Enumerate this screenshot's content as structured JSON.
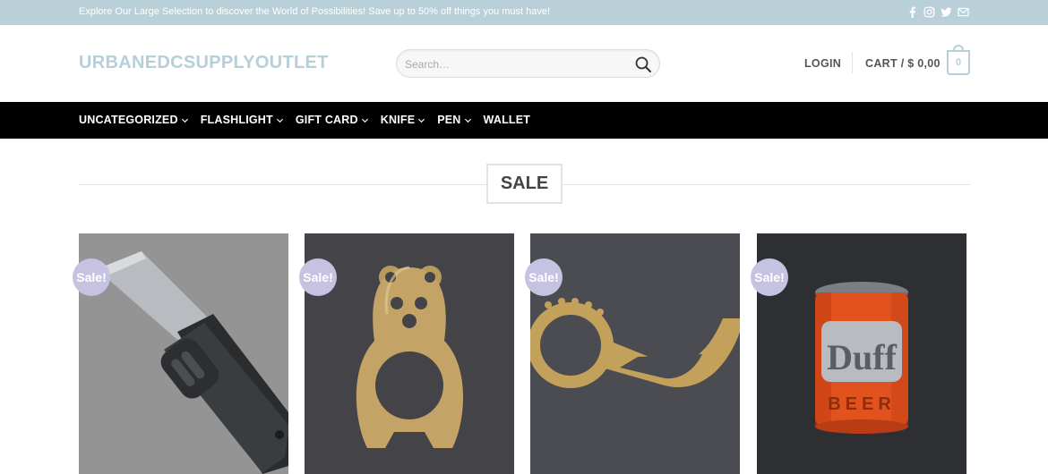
{
  "topbar": {
    "message": "Explore Our Large Selection to discover the World of Possibilities! Save up to 50% off things you must have!",
    "social_icons": [
      "facebook-icon",
      "instagram-icon",
      "twitter-icon",
      "email-icon"
    ]
  },
  "header": {
    "logo": "URBANEDCSUPPLYOUTLET",
    "search_placeholder": "Search…",
    "login_label": "LOGIN",
    "cart_label": "CART / $ 0,00",
    "cart_count": "0"
  },
  "nav": {
    "items": [
      {
        "label": "UNCATEGORIZED",
        "has_dropdown": true
      },
      {
        "label": "FLASHLIGHT",
        "has_dropdown": true
      },
      {
        "label": "GIFT CARD",
        "has_dropdown": true
      },
      {
        "label": "KNIFE",
        "has_dropdown": true
      },
      {
        "label": "PEN",
        "has_dropdown": true
      },
      {
        "label": "WALLET",
        "has_dropdown": false
      }
    ]
  },
  "section": {
    "title": "SALE"
  },
  "products": [
    {
      "badge": "Sale!",
      "image": "folding-knife"
    },
    {
      "badge": "Sale!",
      "image": "brass-bear-opener"
    },
    {
      "badge": "Sale!",
      "image": "brass-ring-tool"
    },
    {
      "badge": "Sale!",
      "image": "duff-beer-can"
    }
  ],
  "colors": {
    "topbar_bg": "#b9d0d8",
    "logo": "#b6cfd8",
    "nav_bg": "#000000",
    "sale_badge": "#c6c2e2"
  }
}
